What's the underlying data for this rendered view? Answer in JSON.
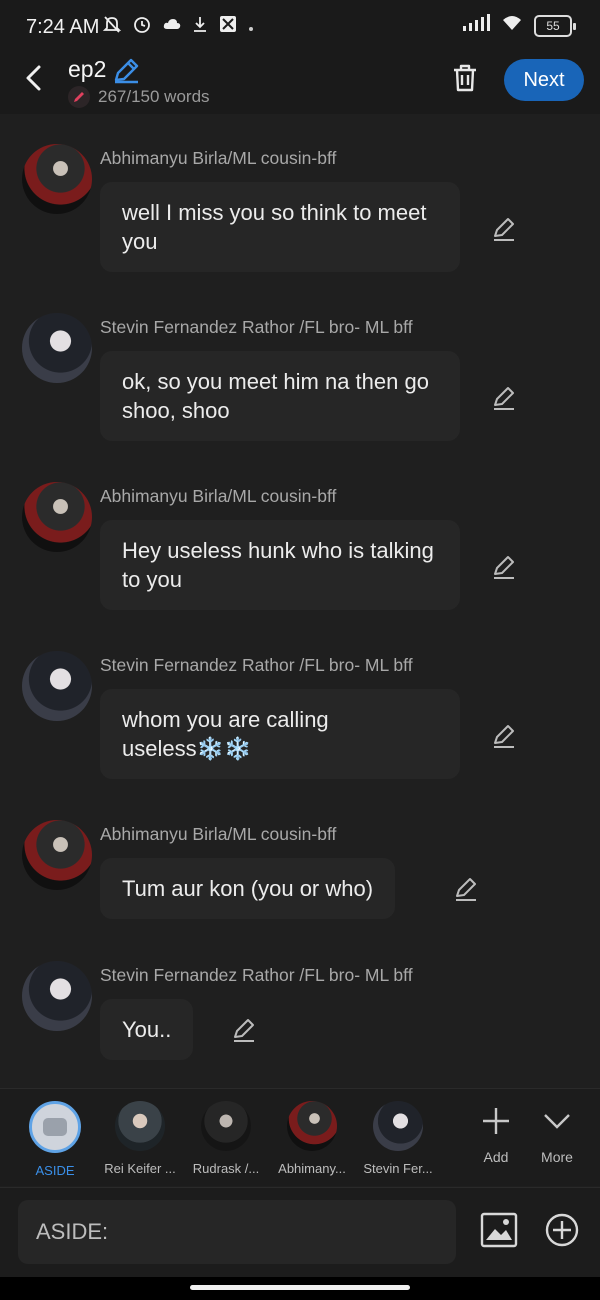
{
  "status": {
    "time": "7:24 AM",
    "battery": "55"
  },
  "header": {
    "title": "ep2",
    "word_count": "267/150 words",
    "next_label": "Next"
  },
  "messages": [
    {
      "sender": "Abhimanyu Birla/ML cousin-bff",
      "text": "well I miss you so think to meet you",
      "avatar": "abhimanyu"
    },
    {
      "sender": "Stevin Fernandez Rathor /FL bro- ML bff",
      "text": "ok, so you meet him na then go shoo, shoo",
      "avatar": "stevin"
    },
    {
      "sender": "Abhimanyu Birla/ML cousin-bff",
      "text": "Hey useless hunk who is talking to you",
      "avatar": "abhimanyu"
    },
    {
      "sender": "Stevin Fernandez Rathor /FL bro- ML bff",
      "text": "whom you are calling useless❄️❄️",
      "avatar": "stevin"
    },
    {
      "sender": "Abhimanyu Birla/ML cousin-bff",
      "text": "Tum aur kon (you or who)",
      "avatar": "abhimanyu"
    },
    {
      "sender": "Stevin Fernandez Rathor /FL bro- ML bff",
      "text": "You..",
      "avatar": "stevin"
    }
  ],
  "characters": [
    {
      "name": "ASIDE",
      "active": true
    },
    {
      "name": "Rei Keifer ..."
    },
    {
      "name": "Rudrask /..."
    },
    {
      "name": "Abhimany..."
    },
    {
      "name": "Stevin Fer..."
    }
  ],
  "tools": {
    "add_label": "Add",
    "more_label": "More"
  },
  "input": {
    "placeholder": "ASIDE:"
  },
  "colors": {
    "accent": "#1965b8",
    "active_char": "#3a8fe8",
    "background": "#1f1f1f",
    "bubble": "#262626"
  }
}
